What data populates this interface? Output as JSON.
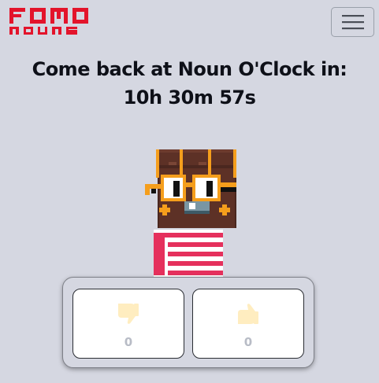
{
  "brand": {
    "logo_text": "FOMO NOUNS",
    "logo_color": "#e3142b"
  },
  "navbar": {
    "menu_icon": "hamburger-menu-icon"
  },
  "countdown": {
    "message": "Come back at Noun O'Clock in:",
    "time": "10h 30m 57s"
  },
  "noun": {
    "head": "chest-brown",
    "glasses": "orange-square-frame",
    "body": "red-white-stripes"
  },
  "votes": {
    "dislike": {
      "icon": "thumbs-down-icon",
      "count": "0"
    },
    "like": {
      "icon": "thumbs-up-icon",
      "count": "0"
    }
  },
  "colors": {
    "background": "#d5d7e1",
    "head": "#5d3126",
    "glasses": "#f59e1c",
    "stripe_red": "#e5305c",
    "stripe_white": "#ffffff"
  }
}
